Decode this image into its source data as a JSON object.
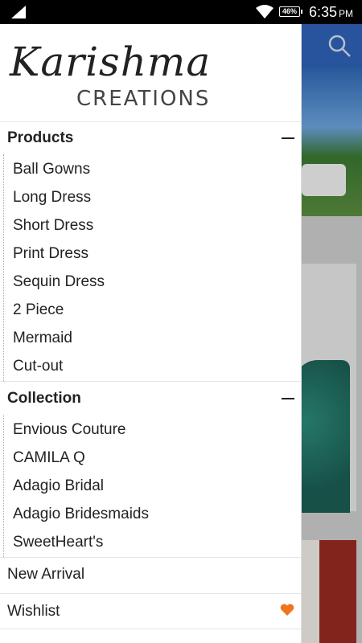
{
  "status_bar": {
    "battery": "46%",
    "time": "6:35",
    "ampm": "PM"
  },
  "brand": {
    "script": "Karishma",
    "sub": "CREATIONS"
  },
  "sections": [
    {
      "title": "Products",
      "items": [
        "Ball Gowns",
        "Long Dress",
        "Short Dress",
        "Print Dress",
        "Sequin Dress",
        "2 Piece",
        "Mermaid",
        "Cut-out"
      ]
    },
    {
      "title": "Collection",
      "items": [
        "Envious Couture",
        "CAMILA Q",
        "Adagio Bridal",
        "Adagio Bridesmaids",
        "SweetHeart's"
      ]
    }
  ],
  "menu": {
    "new_arrival": "New Arrival",
    "wishlist": "Wishlist"
  },
  "colors": {
    "heart": "#f0731f",
    "header_blue": "#2e63b8"
  },
  "icons": [
    "signal-icon",
    "wifi-icon",
    "battery-icon",
    "search-icon",
    "collapse-icon",
    "heart-icon"
  ]
}
